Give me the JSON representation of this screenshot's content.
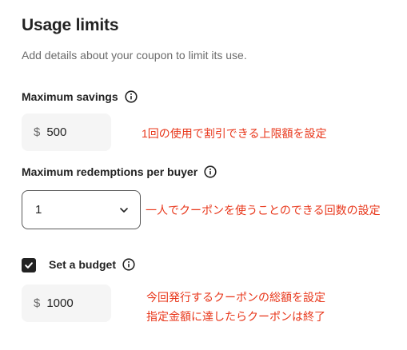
{
  "section": {
    "title": "Usage limits",
    "subtitle": "Add details about your coupon to limit its use."
  },
  "max_savings": {
    "label": "Maximum savings",
    "currency": "$",
    "value": "500",
    "note": "1回の使用で割引できる上限額を設定"
  },
  "max_redemptions": {
    "label": "Maximum redemptions per buyer",
    "selected": "1",
    "note": "一人でクーポンを使うことのできる回数の設定"
  },
  "budget": {
    "label": "Set a budget",
    "checked": true,
    "currency": "$",
    "value": "1000",
    "note_line1": "今回発行するクーポンの総額を設定",
    "note_line2": "指定金額に達したらクーポンは終了"
  },
  "colors": {
    "note_red": "#e8361a",
    "text": "#222222",
    "muted": "#6b6b6b",
    "input_bg": "#f5f5f5"
  },
  "icons": {
    "info": "info-icon",
    "chevron": "chevron-down-icon",
    "check": "checkmark-icon"
  }
}
